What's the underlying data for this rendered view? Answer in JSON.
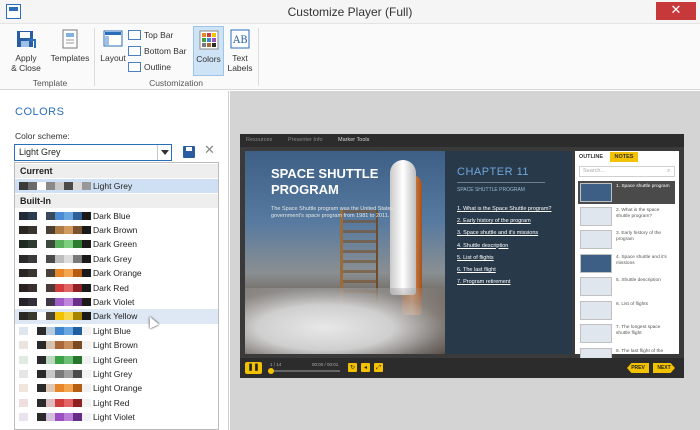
{
  "window": {
    "title": "Customize Player (Full)",
    "close_glyph": "✕",
    "app_icon": "player-window-icon"
  },
  "ribbon": {
    "apply_close": "Apply\n& Close",
    "templates": "Templates",
    "layout": "Layout",
    "top_bar": "Top Bar",
    "bottom_bar": "Bottom Bar",
    "outline": "Outline",
    "colors": "Colors",
    "text_labels": "Text\nLabels",
    "group_template": "Template",
    "group_customization": "Customization"
  },
  "colors_panel": {
    "heading": "COLORS",
    "scheme_label": "Color scheme:",
    "selected_scheme": "Light Grey",
    "delete_glyph": "✕",
    "section_current": "Current",
    "section_builtin": "Built-In",
    "current": {
      "label": "Light Grey",
      "swatches": [
        "#3a3a3a",
        "#6b6b6b",
        "#ffffff",
        "#8a8a8a",
        "#c9c9c9",
        "#4a4a4a",
        "#dadada",
        "#999999"
      ]
    },
    "builtin": [
      {
        "label": "Dark Blue",
        "swatches": [
          "#1e2a38",
          "#2b3b4e",
          "#ffffff",
          "#3a4a5a",
          "#4a8bd1",
          "#6aa6e0",
          "#2e5f99",
          "#1a1a1a"
        ]
      },
      {
        "label": "Dark Brown",
        "swatches": [
          "#2a2622",
          "#3a342e",
          "#ffffff",
          "#4a3f33",
          "#b07a45",
          "#d39a5e",
          "#7a5230",
          "#1a1a1a"
        ]
      },
      {
        "label": "Dark Green",
        "swatches": [
          "#1f2a22",
          "#2e3b30",
          "#ffffff",
          "#3b4a3d",
          "#58b05c",
          "#7ccf7e",
          "#2f7a33",
          "#1a1a1a"
        ]
      },
      {
        "label": "Dark Grey",
        "swatches": [
          "#2a2a2a",
          "#3b3b3b",
          "#ffffff",
          "#4a4a4a",
          "#bdbdbd",
          "#dcdcdc",
          "#7a7a7a",
          "#1a1a1a"
        ]
      },
      {
        "label": "Dark Orange",
        "swatches": [
          "#2a2622",
          "#3b3530",
          "#ffffff",
          "#4a423b",
          "#e8862a",
          "#f3a650",
          "#b55d12",
          "#1a1a1a"
        ]
      },
      {
        "label": "Dark Red",
        "swatches": [
          "#2a2222",
          "#3b2e2e",
          "#ffffff",
          "#4a3a3a",
          "#d03c3c",
          "#e36464",
          "#8e2222",
          "#1a1a1a"
        ]
      },
      {
        "label": "Dark Violet",
        "swatches": [
          "#26222a",
          "#342e3b",
          "#ffffff",
          "#40384a",
          "#a05cc6",
          "#c086dc",
          "#6a3089",
          "#1a1a1a"
        ]
      },
      {
        "label": "Dark Yellow",
        "swatches": [
          "#2a2822",
          "#3b382e",
          "#ffffff",
          "#4a463a",
          "#f2c200",
          "#f7d74a",
          "#a88500",
          "#1a1a1a"
        ]
      },
      {
        "label": "Light Blue",
        "swatches": [
          "#dde6ef",
          "#ffffff",
          "#2a2a2a",
          "#b9cadb",
          "#3e86d0",
          "#6aa6e0",
          "#1f5f9f",
          "#f2f2f2"
        ]
      },
      {
        "label": "Light Brown",
        "swatches": [
          "#ece4dc",
          "#ffffff",
          "#2a2a2a",
          "#d4c2b0",
          "#a8683a",
          "#c98d5d",
          "#7a4a25",
          "#f2f2f2"
        ]
      },
      {
        "label": "Light Green",
        "swatches": [
          "#e0ece1",
          "#ffffff",
          "#2a2a2a",
          "#bfd6c1",
          "#3ea146",
          "#6cc073",
          "#24752b",
          "#f2f2f2"
        ]
      },
      {
        "label": "Light Grey",
        "swatches": [
          "#e6e6e6",
          "#ffffff",
          "#2a2a2a",
          "#c8c8c8",
          "#7a7a7a",
          "#a0a0a0",
          "#4a4a4a",
          "#f2f2f2"
        ]
      },
      {
        "label": "Light Orange",
        "swatches": [
          "#f0e6dc",
          "#ffffff",
          "#2a2a2a",
          "#dcc8b4",
          "#e8862a",
          "#f3a650",
          "#b55d12",
          "#f2f2f2"
        ]
      },
      {
        "label": "Light Red",
        "swatches": [
          "#f0dede",
          "#ffffff",
          "#2a2a2a",
          "#dcbcbc",
          "#d03c3c",
          "#e36464",
          "#8e2222",
          "#f2f2f2"
        ]
      },
      {
        "label": "Light Violet",
        "swatches": [
          "#ebe2f0",
          "#ffffff",
          "#2a2a2a",
          "#d2c0dc",
          "#9b4fc2",
          "#bb7fd9",
          "#652c85",
          "#f2f2f2"
        ]
      }
    ]
  },
  "player": {
    "tabs": [
      "Resources",
      "Presenter Info",
      "Marker Tools"
    ],
    "slide_title": "SPACE SHUTTLE PROGRAM",
    "slide_body": "The Space Shuttle program was the United States government's space program from 1981 to 2011.",
    "chapter_title": "CHAPTER 11",
    "chapter_sub": "SPACE SHUTTLE PROGRAM",
    "chapter_items": [
      "1. What is the Space Shuttle program?",
      "2. Early history of the program",
      "3. Space shuttle and it's missions",
      "4. Shuttle description",
      "5. List of flights",
      "6. The last flight",
      "7. Program retirement"
    ],
    "tab_outline": "OUTLINE",
    "tab_notes": "NOTES",
    "search_placeholder": "Search...",
    "search_glyph": "⌕",
    "outline_items": [
      "1. Space shuttle program",
      "2. What is the space shuttle program?",
      "3. Early history of the program",
      "4. Space shuttle and it's missions",
      "5. Shuttle description",
      "6. List of flights",
      "7. The longest space shuttle flight",
      "8. The last flight of the"
    ],
    "slide_counter": "1 / 14",
    "time_display": "00:00 / 00:01",
    "pause_glyph": "❚❚",
    "prev": "PREV",
    "next": "NEXT"
  }
}
